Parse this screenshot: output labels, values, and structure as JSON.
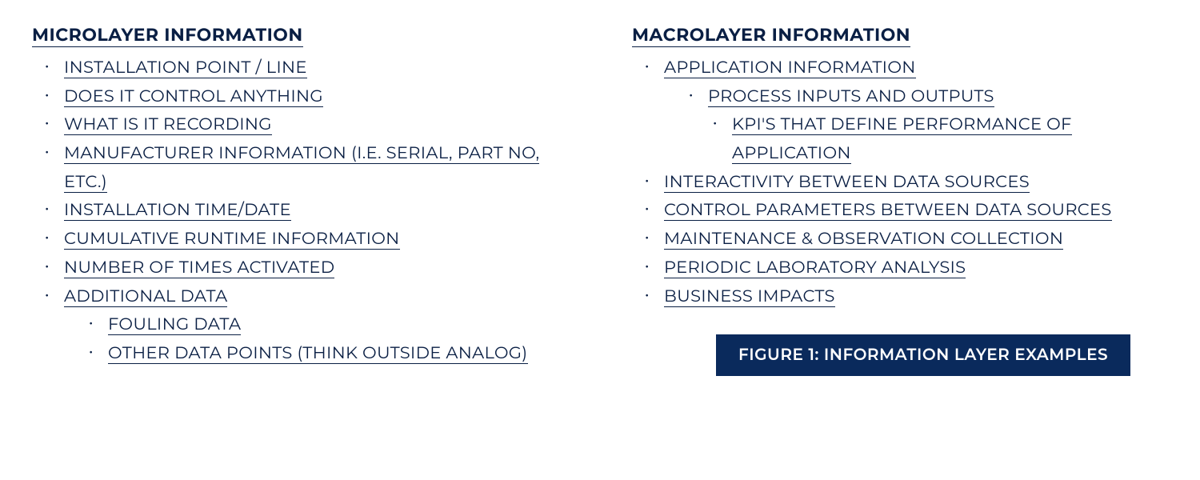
{
  "left": {
    "heading": "MICROLAYER INFORMATION",
    "items": [
      {
        "text": "INSTALLATION POINT / LINE"
      },
      {
        "text": "DOES IT CONTROL ANYTHING"
      },
      {
        "text": "WHAT IS IT RECORDING"
      },
      {
        "text": "MANUFACTURER INFORMATION (I.E. SERIAL, PART NO, ETC.)"
      },
      {
        "text": "INSTALLATION TIME/DATE"
      },
      {
        "text": "CUMULATIVE RUNTIME INFORMATION"
      },
      {
        "text": "NUMBER OF TIMES ACTIVATED"
      },
      {
        "text": "ADDITIONAL DATA",
        "children": [
          {
            "text": "FOULING DATA"
          },
          {
            "text": "OTHER DATA POINTS (THINK OUTSIDE ANALOG)"
          }
        ]
      }
    ]
  },
  "right": {
    "heading": "MACROLAYER INFORMATION",
    "items": [
      {
        "text": "APPLICATION INFORMATION",
        "children": [
          {
            "text": "PROCESS INPUTS AND OUTPUTS",
            "children": [
              {
                "text": "KPI'S THAT DEFINE PERFORMANCE OF APPLICATION"
              }
            ]
          }
        ]
      },
      {
        "text": "INTERACTIVITY BETWEEN DATA SOURCES"
      },
      {
        "text": "CONTROL PARAMETERS BETWEEN DATA SOURCES"
      },
      {
        "text": "MAINTENANCE & OBSERVATION COLLECTION"
      },
      {
        "text": "PERIODIC LABORATORY ANALYSIS"
      },
      {
        "text": "BUSINESS IMPACTS"
      }
    ]
  },
  "caption": "FIGURE 1: INFORMATION LAYER EXAMPLES"
}
